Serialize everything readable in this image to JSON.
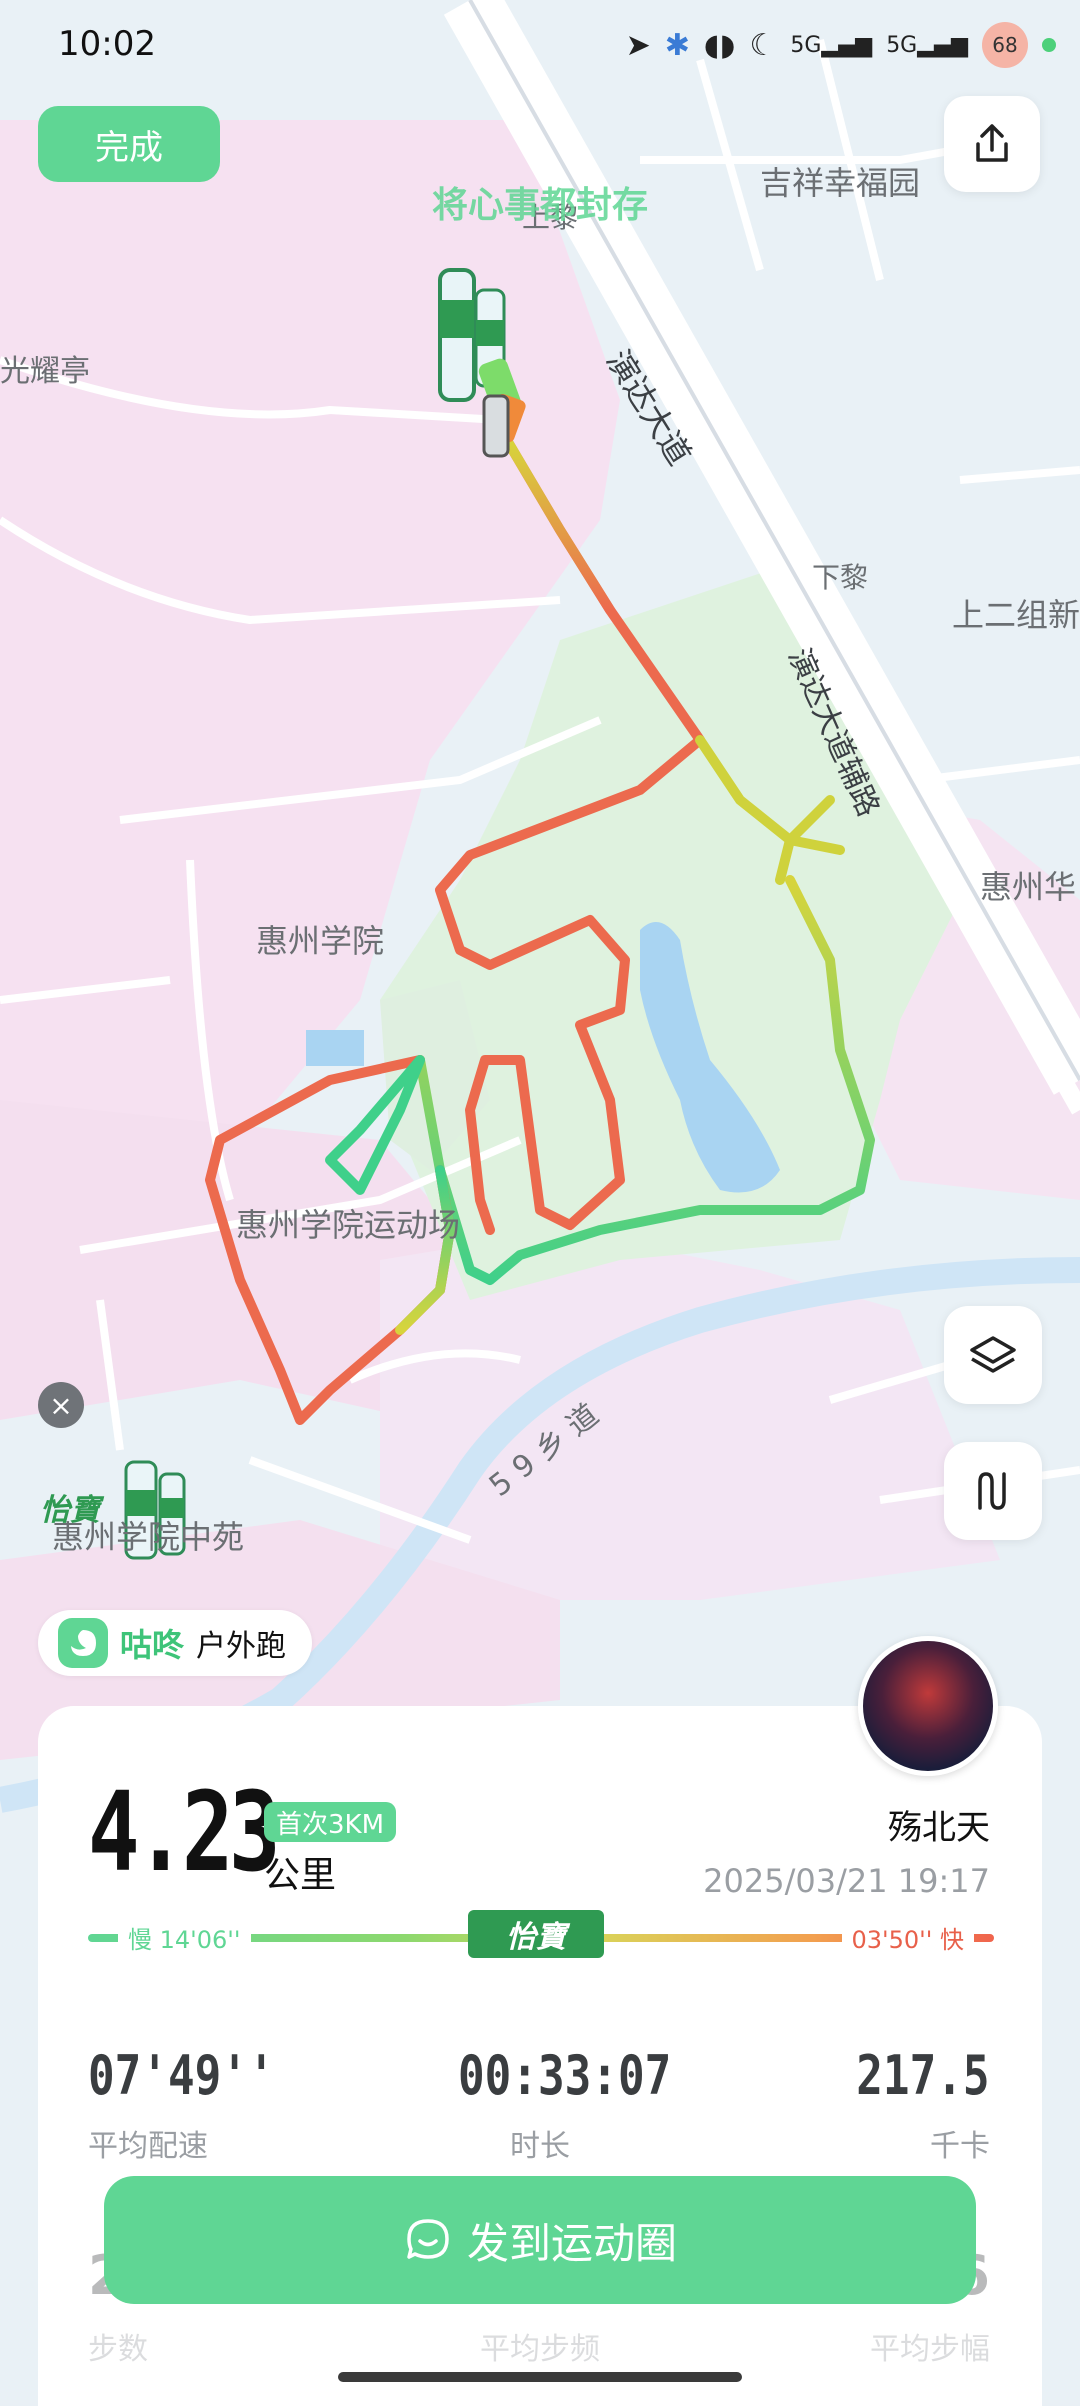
{
  "status_bar": {
    "time": "10:02",
    "icons": [
      "location-arrow-icon",
      "bluetooth-icon",
      "earbuds-icon",
      "moon-icon",
      "signal-5g-icon",
      "signal-5g-icon"
    ],
    "battery": "68"
  },
  "header": {
    "done_label": "完成",
    "ad_text": "将心事都封存"
  },
  "map": {
    "labels": [
      {
        "id": "jixiang",
        "text": "吉祥幸福园"
      },
      {
        "id": "shangli",
        "text": "上黎"
      },
      {
        "id": "guangyao",
        "text": "光耀亭"
      },
      {
        "id": "yanda",
        "text": "演达大道"
      },
      {
        "id": "xiali",
        "text": "下黎"
      },
      {
        "id": "shanger",
        "text": "上二组新"
      },
      {
        "id": "yandafu",
        "text": "演达大道辅路"
      },
      {
        "id": "huizhouhua",
        "text": "惠州华"
      },
      {
        "id": "xueyuan",
        "text": "惠州学院"
      },
      {
        "id": "yundongchang",
        "text": "惠州学院运动场"
      },
      {
        "id": "xiangdao",
        "text": "59乡道"
      },
      {
        "id": "zhongyuan",
        "text": "惠州学院中苑"
      }
    ]
  },
  "brand": {
    "name": "咕咚",
    "activity_type": "户外跑",
    "sponsor": "怡寶"
  },
  "summary": {
    "username": "殇北天",
    "datetime": "2025/03/21 19:17",
    "distance": "4.23",
    "distance_unit": "公里",
    "badge": "首次3KM",
    "pace_slow_label": "慢 14'06''",
    "pace_fast_label": "03'50'' 快",
    "stats": [
      {
        "value": "07'49''",
        "label": "平均配速"
      },
      {
        "value": "00:33:07",
        "label": "时长"
      },
      {
        "value": "217.5",
        "label": "千卡"
      }
    ],
    "ghost_stats": [
      {
        "value": "2",
        "label": "步数"
      },
      {
        "value": "",
        "label": "平均步频"
      },
      {
        "value": "6",
        "label": "平均步幅"
      }
    ]
  },
  "actions": {
    "post_label": "发到运动圈"
  },
  "colors": {
    "accent": "#5fd694",
    "route_slow": "#3fd08a",
    "route_mid": "#d7d43c",
    "route_fast": "#ec6a4e",
    "campus_green": "#dff3df",
    "zone_pink": "#f6e3f3"
  }
}
